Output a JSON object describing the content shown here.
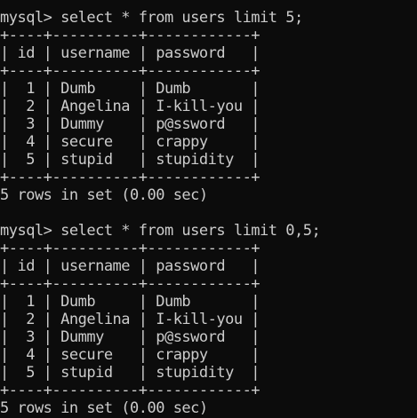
{
  "terminal": {
    "colors": {
      "background": "#0c0c0c",
      "foreground": "#cccccc"
    },
    "lines": [
      "mysql> select * from users limit 5;",
      "+----+----------+------------+",
      "| id | username | password   |",
      "+----+----------+------------+",
      "|  1 | Dumb     | Dumb       |",
      "|  2 | Angelina | I-kill-you |",
      "|  3 | Dummy    | p@ssword   |",
      "|  4 | secure   | crappy     |",
      "|  5 | stupid   | stupidity  |",
      "+----+----------+------------+",
      "5 rows in set (0.00 sec)",
      "",
      "mysql> select * from users limit 0,5;",
      "+----+----------+------------+",
      "| id | username | password   |",
      "+----+----------+------------+",
      "|  1 | Dumb     | Dumb       |",
      "|  2 | Angelina | I-kill-you |",
      "|  3 | Dummy    | p@ssword   |",
      "|  4 | secure   | crappy     |",
      "|  5 | stupid   | stupidity  |",
      "+----+----------+------------+",
      "5 rows in set (0.00 sec)"
    ]
  }
}
